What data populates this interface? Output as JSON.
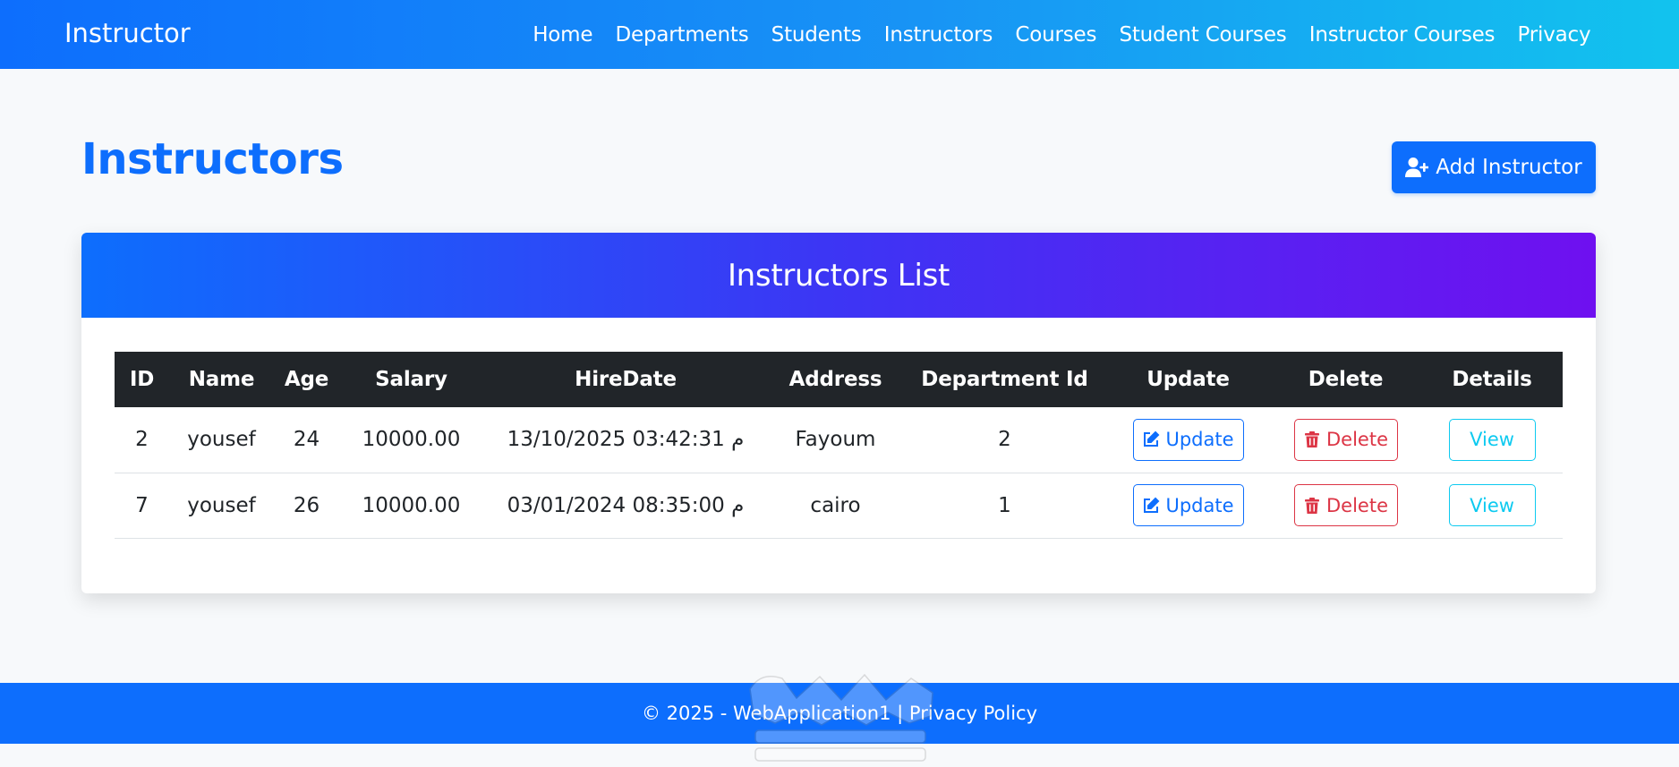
{
  "navbar": {
    "brand": "Instructor",
    "links": [
      "Home",
      "Departments",
      "Students",
      "Instructors",
      "Courses",
      "Student Courses",
      "Instructor Courses",
      "Privacy"
    ]
  },
  "page": {
    "title": "Instructors",
    "add_button_label": "Add Instructor"
  },
  "card": {
    "title": "Instructors List"
  },
  "table": {
    "headers": [
      "ID",
      "Name",
      "Age",
      "Salary",
      "HireDate",
      "Address",
      "Department Id",
      "Update",
      "Delete",
      "Details"
    ],
    "rows": [
      {
        "id": "2",
        "name": "yousef",
        "age": "24",
        "salary": "10000.00",
        "hire_date": "13/10/2025 03:42:31 م",
        "address": "Fayoum",
        "department_id": "2"
      },
      {
        "id": "7",
        "name": "yousef",
        "age": "26",
        "salary": "10000.00",
        "hire_date": "03/01/2024 08:35:00 م",
        "address": "cairo",
        "department_id": "1"
      }
    ],
    "update_label": "Update",
    "delete_label": "Delete",
    "view_label": "View"
  },
  "footer": {
    "copyright": "© 2025 - WebApplication1 |",
    "privacy_link": "Privacy Policy"
  },
  "colors": {
    "primary": "#0d6efd",
    "danger": "#dc3545",
    "info": "#0dcaf0",
    "dark": "#212529"
  },
  "icons": {
    "add": "user-plus-icon",
    "update": "edit-icon",
    "delete": "trash-icon"
  }
}
